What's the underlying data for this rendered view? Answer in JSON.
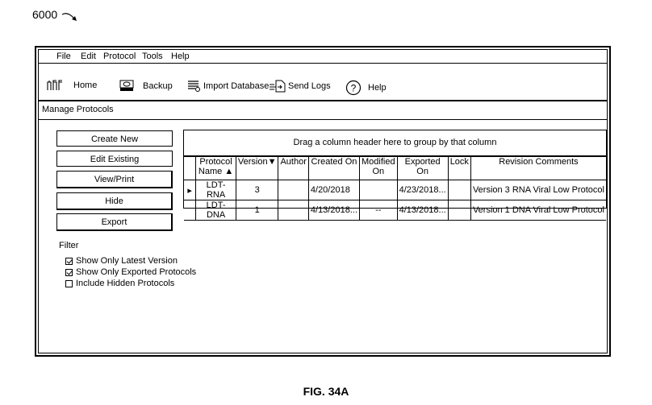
{
  "figure": {
    "ref_label": "6000",
    "caption": "FIG. 34A"
  },
  "menu": [
    "File",
    "Edit",
    "Protocol",
    "Tools",
    "Help"
  ],
  "toolbar": [
    {
      "label": "Home",
      "icon": "home-bars-icon"
    },
    {
      "label": "Backup",
      "icon": "disk-drive-icon"
    },
    {
      "label": "Import Database",
      "icon": "import-database-icon"
    },
    {
      "label": "Send Logs",
      "icon": "send-document-icon"
    },
    {
      "label": "Help",
      "icon": "question-circle-icon"
    }
  ],
  "section_title": "Manage Protocols",
  "actions": [
    "Create New",
    "Edit Existing",
    "View/Print",
    "Hide",
    "Export"
  ],
  "filter": {
    "label": "Filter",
    "options": [
      {
        "label": "Show Only Latest Version",
        "checked": true
      },
      {
        "label": "Show Only Exported Protocols",
        "checked": true
      },
      {
        "label": "Include Hidden Protocols",
        "checked": false
      }
    ]
  },
  "grid": {
    "group_hint": "Drag a column header here to group by that column",
    "columns": [
      {
        "label": "Protocol Name",
        "sort": "asc"
      },
      {
        "label": "Version",
        "sort": "desc"
      },
      {
        "label": "Author",
        "sort": null
      },
      {
        "label": "Created On",
        "sort": null
      },
      {
        "label": "Modified On",
        "sort": null
      },
      {
        "label": "Exported On",
        "sort": null
      },
      {
        "label": "Lock",
        "sort": null
      },
      {
        "label": "Revision Comments",
        "sort": null
      }
    ],
    "rows": [
      {
        "selected": true,
        "cells": [
          "LDT-RNA",
          "3",
          "",
          "4/20/2018",
          "",
          "4/23/2018...",
          "",
          "Version 3 RNA Viral Low Protocol"
        ]
      },
      {
        "selected": false,
        "cells": [
          "LDT-DNA",
          "1",
          "",
          "4/13/2018...",
          "--",
          "4/13/2018...",
          "",
          "Version 1 DNA Viral Low Protocol"
        ]
      }
    ]
  }
}
